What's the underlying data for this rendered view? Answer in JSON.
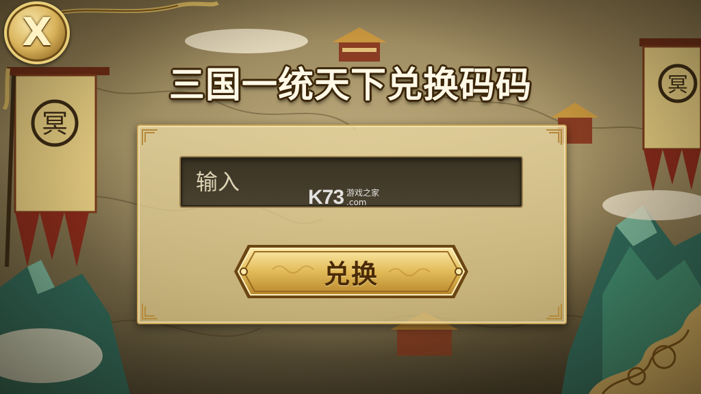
{
  "title": "三国一统天下兑换码码",
  "redeem": {
    "input_placeholder": "输入",
    "input_value": "",
    "button_label": "兑换"
  },
  "close": {
    "glyph": "X"
  },
  "watermark": {
    "logo": "K73",
    "line1": "游戏之家",
    "line2": ".com"
  },
  "banner": {
    "emblem_glyph": "冥"
  },
  "colors": {
    "gold": "#d8b25a",
    "panel": "#e4d39c",
    "input_bg": "#3e3726",
    "title_text": "#fff8e6",
    "title_outline": "#3a2508",
    "button_text": "#4a2a06"
  }
}
